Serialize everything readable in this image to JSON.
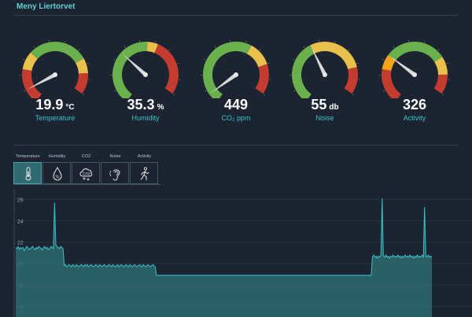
{
  "header": {
    "title": "Meny Liertorvet"
  },
  "gauges": [
    {
      "value": "19.9",
      "unit": "°C",
      "label": "Temperature",
      "needle_fraction": 0.1
    },
    {
      "value": "35.3",
      "unit": "%",
      "label": "Humidity",
      "needle_fraction": 0.36
    },
    {
      "value": "449",
      "unit": "",
      "label": "CO₂ ppm",
      "needle_fraction": 0.07
    },
    {
      "value": "55",
      "unit": "db",
      "label": "Noise",
      "needle_fraction": 0.44
    },
    {
      "value": "326",
      "unit": "",
      "label": "Activity",
      "needle_fraction": 0.34
    }
  ],
  "tabs": [
    {
      "label": "Temperature",
      "icon": "thermometer-icon"
    },
    {
      "label": "Humidity",
      "icon": "humidity-drop-icon"
    },
    {
      "label": "CO2",
      "icon": "co2-cloud-icon"
    },
    {
      "label": "Noise",
      "icon": "ear-icon"
    },
    {
      "label": "Activity",
      "icon": "walking-person-icon"
    }
  ],
  "colors": {
    "accent": "#38c3c9",
    "green": "#6ab04c",
    "yellow": "#e9c04c",
    "red": "#c43c30",
    "orange": "#f3a51a",
    "background": "#1b2430",
    "area_fill": "#2e6a70"
  },
  "chart_data": {
    "type": "area",
    "ylim": [
      15,
      27
    ],
    "yticks": [
      "26",
      "24",
      "22",
      "20",
      "18",
      "16"
    ],
    "grid": true,
    "series": [
      {
        "values": [
          21.5,
          21.4,
          21.6,
          21.3,
          21.5,
          21.4,
          21.5,
          21.2,
          21.4,
          21.6,
          21.5,
          21.3,
          21.4,
          21.5,
          21.6,
          21.4,
          21.3,
          21.5,
          21.4,
          21.6,
          21.5,
          21.4,
          21.3,
          21.5,
          21.6,
          21.4,
          21.5,
          21.3,
          21.4,
          21.6,
          21.5,
          21.4,
          25.7,
          21.8,
          21.6,
          21.5,
          21.4,
          21.6,
          21.5,
          21.4,
          19.8,
          19.9,
          19.7,
          19.8,
          19.9,
          19.8,
          19.7,
          19.9,
          19.8,
          19.7,
          19.9,
          19.8,
          19.7,
          19.8,
          19.9,
          19.8,
          19.7,
          19.9,
          19.8,
          19.9,
          19.7,
          19.8,
          19.9,
          19.8,
          19.7,
          19.8,
          19.9,
          19.8,
          19.7,
          19.9,
          19.8,
          19.7,
          19.8,
          19.9,
          19.8,
          19.7,
          19.8,
          19.9,
          19.8,
          19.7,
          19.9,
          19.8,
          19.7,
          19.8,
          19.9,
          19.7,
          19.8,
          19.9,
          19.8,
          19.7,
          19.8,
          19.9,
          19.8,
          19.7,
          19.9,
          19.8,
          19.7,
          19.8,
          19.9,
          19.8,
          19.7,
          19.8,
          19.9,
          19.8,
          19.7,
          19.9,
          19.8,
          19.7,
          19.8,
          19.9,
          19.8,
          19.7,
          19.8,
          19.9,
          19.8,
          19.7,
          18.9,
          18.9,
          18.9,
          18.9,
          18.9,
          18.9,
          18.9,
          18.9,
          18.9,
          18.9,
          18.9,
          18.9,
          18.9,
          18.9,
          18.9,
          18.9,
          18.9,
          18.9,
          18.9,
          18.9,
          18.9,
          18.9,
          18.9,
          18.9,
          18.9,
          18.9,
          18.9,
          18.9,
          18.9,
          18.9,
          18.9,
          18.9,
          18.9,
          18.9,
          18.9,
          18.9,
          18.9,
          18.9,
          18.9,
          18.9,
          18.9,
          18.9,
          18.9,
          18.9,
          18.9,
          18.9,
          18.9,
          18.9,
          18.9,
          18.9,
          18.9,
          18.9,
          18.9,
          18.9,
          18.9,
          18.9,
          18.9,
          18.9,
          18.9,
          18.9,
          18.9,
          18.9,
          18.9,
          18.9,
          18.9,
          18.9,
          18.9,
          18.9,
          18.9,
          18.9,
          18.9,
          18.9,
          18.9,
          18.9,
          18.9,
          18.9,
          18.9,
          18.9,
          18.9,
          18.9,
          18.9,
          18.9,
          18.9,
          18.9,
          18.9,
          18.9,
          18.9,
          18.9,
          18.9,
          18.9,
          18.9,
          18.9,
          18.9,
          18.9,
          18.9,
          18.9,
          18.9,
          18.9,
          18.9,
          18.9,
          18.9,
          18.9,
          18.9,
          18.9,
          18.9,
          18.9,
          18.9,
          18.9,
          18.9,
          18.9,
          18.9,
          18.9,
          18.9,
          18.9,
          18.9,
          18.9,
          18.9,
          18.9,
          18.9,
          18.9,
          18.9,
          18.9,
          18.9,
          18.9,
          18.9,
          18.9,
          18.9,
          18.9,
          18.9,
          18.9,
          18.9,
          18.9,
          18.9,
          18.9,
          18.9,
          18.9,
          18.9,
          18.9,
          18.9,
          18.9,
          18.9,
          18.9,
          18.9,
          18.9,
          18.9,
          18.9,
          18.9,
          18.9,
          18.9,
          18.9,
          18.9,
          18.9,
          18.9,
          18.9,
          18.9,
          18.9,
          18.9,
          18.9,
          18.9,
          18.9,
          18.9,
          18.9,
          18.9,
          18.9,
          18.9,
          18.9,
          18.9,
          18.9,
          18.9,
          18.9,
          18.9,
          18.9,
          18.9,
          18.9,
          18.9,
          18.9,
          18.9,
          18.9,
          20.6,
          20.8,
          20.6,
          20.7,
          20.5,
          20.7,
          20.6,
          20.8,
          26.1,
          20.7,
          20.6,
          20.8,
          20.6,
          20.7,
          20.5,
          20.7,
          20.6,
          20.8,
          20.6,
          20.7,
          20.6,
          20.8,
          20.6,
          20.7,
          20.5,
          20.7,
          20.6,
          20.8,
          20.6,
          20.7,
          20.6,
          20.8,
          20.6,
          20.7,
          20.5,
          20.7,
          20.6,
          20.8,
          20.6,
          20.7,
          20.6,
          20.8,
          20.6,
          25.3,
          20.7,
          20.6,
          20.8,
          20.6,
          20.7,
          20.6
        ]
      }
    ]
  }
}
